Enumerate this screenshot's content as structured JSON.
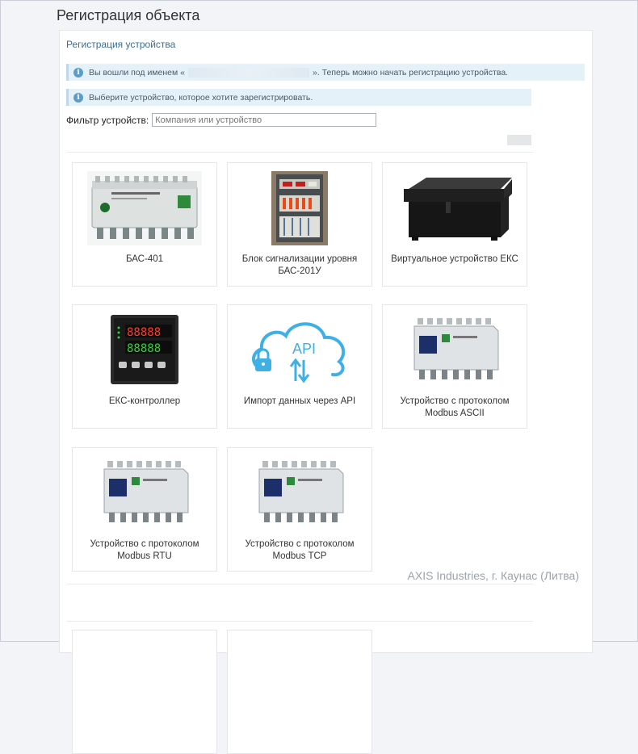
{
  "page": {
    "title": "Регистрация объекта"
  },
  "panel": {
    "header": "Регистрация устройства"
  },
  "alerts": {
    "login_prefix": "Вы вошли под именем «",
    "login_suffix": "». Теперь можно начать регистрацию устройства.",
    "choose": "Выберите устройство, которое хотите зарегистрировать."
  },
  "filter": {
    "label": "Фильтр устройств:",
    "placeholder": "Компания или устройство",
    "value": ""
  },
  "devices": [
    {
      "label": "БАС-401",
      "icon": "bas401-device-image"
    },
    {
      "label": "Блок сигнализации уровня БАС-201У",
      "icon": "cabinet-device-image"
    },
    {
      "label": "Виртуальное устройство ЕКС",
      "icon": "box-device-image"
    },
    {
      "label": "ЕКС-контроллер",
      "icon": "controller-device-image"
    },
    {
      "label": "Импорт данных через API",
      "icon": "api-cloud-image"
    },
    {
      "label": "Устройство с протоколом Modbus ASCII",
      "icon": "modbus-device-image"
    },
    {
      "label": "Устройство с протоколом Modbus RTU",
      "icon": "modbus-device-image"
    },
    {
      "label": "Устройство с протоколом Modbus TCP",
      "icon": "modbus-device-image"
    }
  ],
  "company": {
    "name": "AXIS Industries, г. Каунас (Литва)"
  },
  "colors": {
    "accent": "#3a6f93",
    "alert_bg": "#e5f1f9",
    "info_icon": "#5d9cc8",
    "api_blue": "#3fb0e6"
  }
}
